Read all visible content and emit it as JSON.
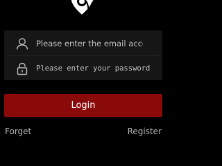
{
  "logo": {
    "icon": "location-pin-logo"
  },
  "login_form": {
    "email": {
      "icon": "user-icon",
      "placeholder": "Please enter the email account nu",
      "value": ""
    },
    "password": {
      "icon": "lock-icon",
      "placeholder": "Please enter your password",
      "value": ""
    },
    "login_label": "Login"
  },
  "links": {
    "forget_label": "Forget",
    "register_label": "Register"
  },
  "colors": {
    "background": "#000000",
    "card": "#161616",
    "accent": "#8a0a0a",
    "link_text": "#b5b5b5"
  }
}
